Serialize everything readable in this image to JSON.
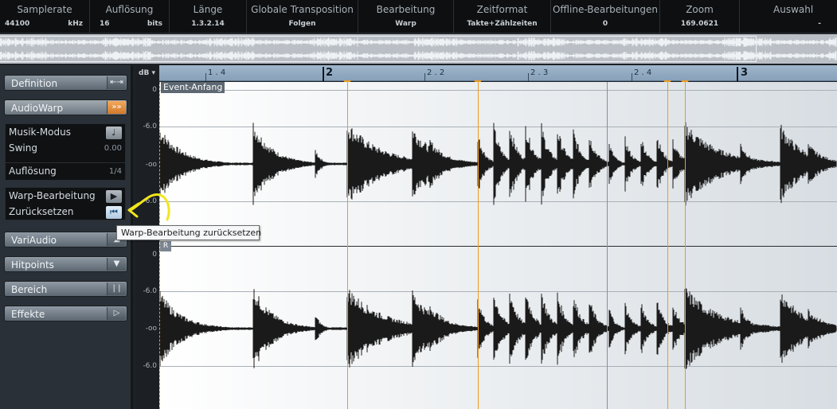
{
  "infobar": [
    {
      "label": "Samplerate",
      "value": "44100",
      "unit": "kHz"
    },
    {
      "label": "Auflösung",
      "value": "16",
      "unit": "bits"
    },
    {
      "label": "Länge",
      "value": "1.3.2.14"
    },
    {
      "label": "Globale Transposition",
      "value": "Folgen"
    },
    {
      "label": "Bearbeitung",
      "value": "Warp"
    },
    {
      "label": "Zeitformat",
      "value": "Takte+Zählzeiten"
    },
    {
      "label": "Offline-Bearbeitungen",
      "value": "0"
    },
    {
      "label": "Zoom",
      "value": "169.0621"
    },
    {
      "label": "Auswahl",
      "value": "-"
    }
  ],
  "sidebar": {
    "definition": "Definition",
    "audiowarp": "AudioWarp",
    "musik_modus": "Musik-Modus",
    "swing": "Swing",
    "swing_value": "0.00",
    "aufloesung": "Auflösung",
    "aufloesung_value": "1/4",
    "warp_bearbeitung": "Warp-Bearbeitung",
    "zuruecksetzen": "Zurücksetzen",
    "variaudio": "VariAudio",
    "hitpoints": "Hitpoints",
    "bereich": "Bereich",
    "effekte": "Effekte"
  },
  "db_scale": {
    "header": "dB",
    "labels": [
      "0",
      "-6.0",
      "-oo",
      "-6.0",
      "0",
      "-6.0",
      "-oo",
      "-6.0"
    ]
  },
  "ruler": {
    "labels": [
      "1 . 4",
      "2",
      "2 . 2",
      "2 . 3",
      "2 . 4",
      "3"
    ]
  },
  "event_label": "Event-Anfang",
  "channel_badge": "R",
  "tooltip": "Warp-Bearbeitung zurücksetzen",
  "colors": {
    "warp_marker": "#ee9a1e",
    "ruler": "#93abc2",
    "waveform": "#1a1a1a",
    "annotation": "#f2e51c"
  }
}
